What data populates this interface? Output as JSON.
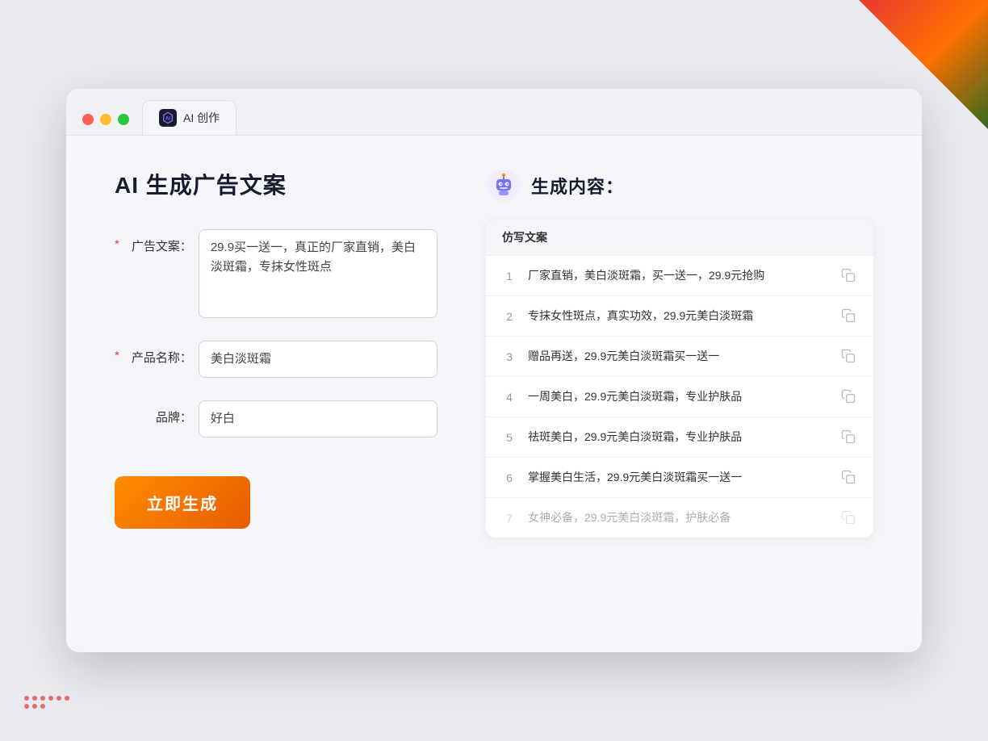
{
  "window": {
    "tab_label": "AI 创作",
    "controls": {
      "close": "close",
      "minimize": "minimize",
      "maximize": "maximize"
    }
  },
  "left_panel": {
    "title": "AI 生成广告文案",
    "form": {
      "ad_copy_label": "广告文案：",
      "ad_copy_required": "*",
      "ad_copy_value": "29.9买一送一，真正的厂家直销，美白淡斑霜，专抹女性斑点",
      "product_name_label": "产品名称：",
      "product_name_required": "*",
      "product_name_value": "美白淡斑霜",
      "brand_label": "品牌：",
      "brand_value": "好白"
    },
    "generate_btn": "立即生成"
  },
  "right_panel": {
    "title": "生成内容：",
    "table_header": "仿写文案",
    "results": [
      {
        "num": "1",
        "text": "厂家直销，美白淡斑霜，买一送一，29.9元抢购",
        "faded": false
      },
      {
        "num": "2",
        "text": "专抹女性斑点，真实功效，29.9元美白淡斑霜",
        "faded": false
      },
      {
        "num": "3",
        "text": "赠品再送，29.9元美白淡斑霜买一送一",
        "faded": false
      },
      {
        "num": "4",
        "text": "一周美白，29.9元美白淡斑霜，专业护肤品",
        "faded": false
      },
      {
        "num": "5",
        "text": "祛斑美白，29.9元美白淡斑霜，专业护肤品",
        "faded": false
      },
      {
        "num": "6",
        "text": "掌握美白生活，29.9元美白淡斑霜买一送一",
        "faded": false
      },
      {
        "num": "7",
        "text": "女神必备，29.9元美白淡斑霜，护肤必备",
        "faded": true
      }
    ]
  },
  "colors": {
    "accent_orange": "#e65c00",
    "tab_bg": "#f5f6fa",
    "required_red": "#e53935"
  }
}
